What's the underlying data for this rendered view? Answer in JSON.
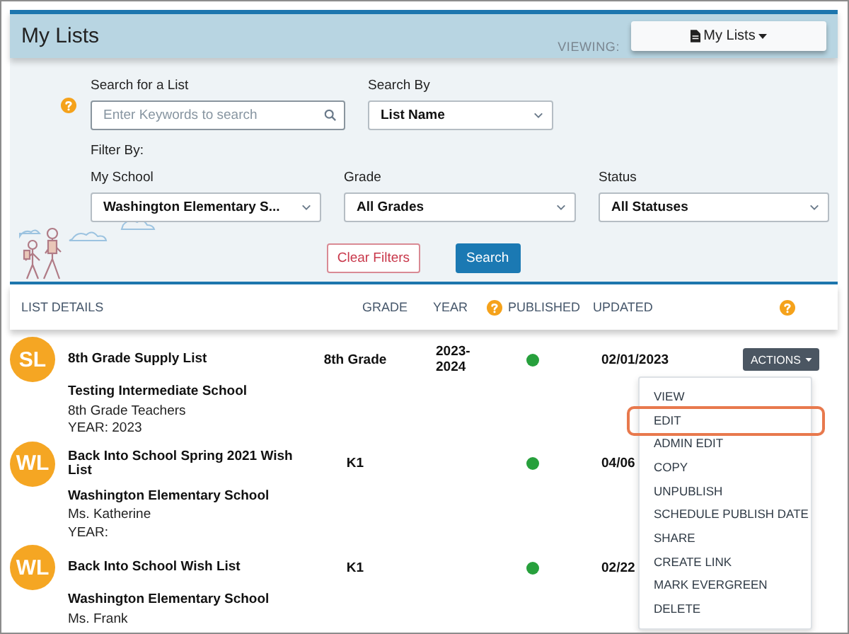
{
  "header": {
    "title": "My Lists",
    "viewing_label": "VIEWING:",
    "viewing_button": "My Lists"
  },
  "filters": {
    "search": {
      "label": "Search for a List",
      "placeholder": "Enter Keywords to search"
    },
    "search_by": {
      "label": "Search By",
      "value": "List Name"
    },
    "filter_by_label": "Filter By:",
    "dropdowns": [
      {
        "label": "My School",
        "value": "Washington Elementary S..."
      },
      {
        "label": "Grade",
        "value": "All Grades"
      },
      {
        "label": "Status",
        "value": "All Statuses"
      }
    ],
    "clear_button": "Clear Filters",
    "search_button": "Search"
  },
  "table": {
    "columns": [
      "LIST DETAILS",
      "GRADE",
      "YEAR",
      "PUBLISHED",
      "UPDATED"
    ],
    "rows": [
      {
        "initials": "SL",
        "name": "8th Grade Supply List",
        "grade": "8th Grade",
        "year": "2023-2024",
        "published": true,
        "updated": "02/01/2023",
        "actions": "ACTIONS",
        "school": "Testing Intermediate School",
        "teacher": "8th Grade Teachers",
        "year_line": "YEAR: 2023"
      },
      {
        "initials": "WL",
        "name": "Back Into School Spring 2021 Wish List",
        "grade": "K1",
        "published": true,
        "updated": "04/06",
        "school": "Washington Elementary School",
        "teacher": "Ms. Katherine",
        "year_line": "YEAR:"
      },
      {
        "initials": "WL",
        "name": "Back Into School Wish List",
        "grade": "K1",
        "published": true,
        "updated": "02/22",
        "school": "Washington Elementary School",
        "teacher": "Ms. Frank"
      }
    ]
  },
  "actions_menu": {
    "items": [
      {
        "label": "VIEW",
        "highlighted": false
      },
      {
        "label": "EDIT",
        "highlighted": true
      },
      {
        "label": "ADMIN EDIT",
        "highlighted": false
      },
      {
        "label": "COPY",
        "highlighted": false
      },
      {
        "label": "UNPUBLISH",
        "highlighted": false
      },
      {
        "label": "SCHEDULE PUBLISH DATE",
        "highlighted": false
      },
      {
        "label": "SHARE",
        "highlighted": false
      },
      {
        "label": "CREATE LINK",
        "highlighted": false
      },
      {
        "label": "MARK EVERGREEN",
        "highlighted": false
      },
      {
        "label": "DELETE",
        "highlighted": false
      }
    ]
  }
}
